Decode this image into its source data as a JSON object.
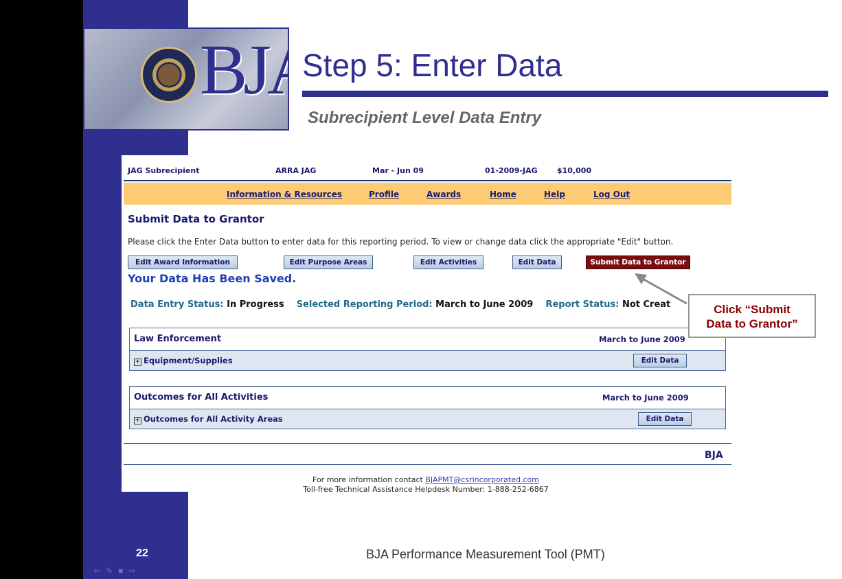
{
  "slide": {
    "title": "Step 5: Enter Data",
    "subtitle": "Subrecipient Level Data Entry",
    "logo_text": "BJA",
    "page_number": "22",
    "footer": "BJA Performance Measurement Tool (PMT)"
  },
  "app": {
    "top_row": {
      "role": "JAG Subrecipient",
      "program": "ARRA JAG",
      "period": "Mar - Jun 09",
      "award_number": "01-2009-JAG",
      "amount": "$10,000"
    },
    "nav": [
      "Information & Resources",
      "Profile",
      "Awards",
      "Home",
      "Help",
      "Log Out"
    ],
    "page_title": "Submit Data to Grantor",
    "instructions": "Please click the Enter Data button to enter data for this reporting period. To view or change data click the appropriate \"Edit\" button.",
    "buttons": {
      "edit_award": "Edit Award Information",
      "edit_purpose": "Edit Purpose Areas",
      "edit_activities": "Edit Activities",
      "edit_data": "Edit Data",
      "submit": "Submit Data to Grantor"
    },
    "saved_message": "Your Data Has Been Saved.",
    "status": {
      "entry_label": "Data Entry Status:",
      "entry_value": "In Progress",
      "period_label": "Selected Reporting Period:",
      "period_value": "March to June 2009",
      "report_label": "Report Status:",
      "report_value": "Not Creat"
    },
    "panels": [
      {
        "title": "Law Enforcement",
        "period": "March to June 2009",
        "item": "Equipment/Supplies",
        "button": "Edit Data"
      },
      {
        "title": "Outcomes for All Activities",
        "period": "March to June 2009",
        "item": "Outcomes for All Activity Areas",
        "button": "Edit Data"
      }
    ],
    "footer_logo": "BJA",
    "contact": {
      "prefix": "For more information contact",
      "email": "BJAPMT@csrincorporated.com",
      "helpdesk": "Toll-free Technical Assistance Helpdesk Number: 1-888-252-6867"
    }
  },
  "callout": {
    "line1": "Click “Submit",
    "line2": "Data to Grantor”"
  },
  "colors": {
    "navy": "#2f2f8f",
    "nav_bar": "#fccb74",
    "submit_button": "#7a0d0d",
    "callout_text": "#8b0000"
  }
}
